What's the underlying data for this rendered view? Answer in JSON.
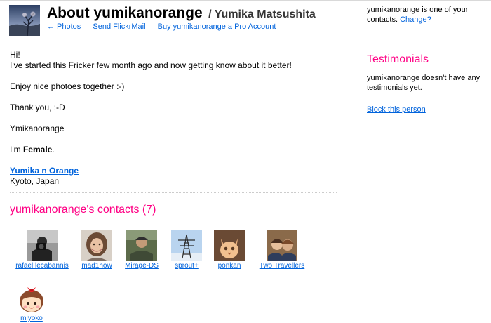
{
  "header": {
    "title": "About yumikanorange",
    "real_name": "/ Yumika Matsushita",
    "nav": [
      {
        "label": "← Photos"
      },
      {
        "label": "Send FlickrMail"
      },
      {
        "label": "Buy yumikanorange a Pro Account"
      }
    ]
  },
  "sidebar": {
    "contact_note": "yumikanorange is one of your contacts.",
    "change_label": "Change?",
    "testimonials_heading": "Testimonials",
    "testimonials_text": "yumikanorange doesn't have any testimonials yet.",
    "block_label": "Block this person"
  },
  "profile": {
    "greeting": "Hi!",
    "intro": "I've started this Fricker few month ago and now getting know about it better!",
    "line2": "Enjoy nice photoes together :-)",
    "line3": "Thank you, :-D",
    "line4": "Ymikanorange",
    "gender_prefix": "I'm ",
    "gender": "Female",
    "gender_suffix": ".",
    "name_link": "Yumika n Orange",
    "location": "Kyoto, Japan"
  },
  "contacts": {
    "heading": "yumikanorange's contacts (7)",
    "items": [
      {
        "name": "rafael lecabannis",
        "icon": "photographer-avatar"
      },
      {
        "name": "mad1how",
        "icon": "woman-portrait-avatar"
      },
      {
        "name": "Mirage-DS",
        "icon": "man-outdoor-avatar"
      },
      {
        "name": "sprout+",
        "icon": "power-tower-avatar"
      },
      {
        "name": "ponkan",
        "icon": "cat-avatar"
      },
      {
        "name": "Two Travellers",
        "icon": "couple-avatar"
      },
      {
        "name": "miyoko",
        "icon": "cartoon-girl-avatar"
      }
    ]
  }
}
